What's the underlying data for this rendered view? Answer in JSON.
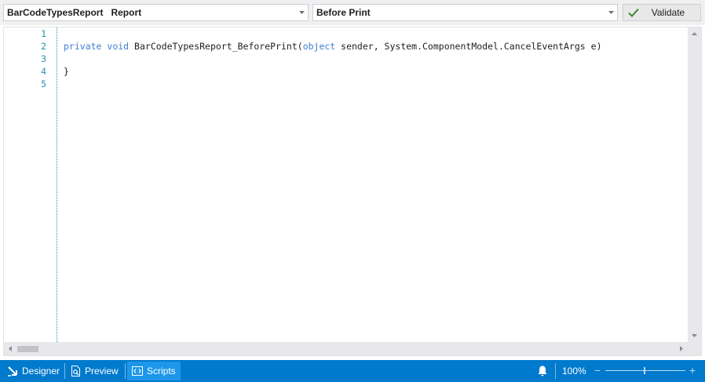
{
  "toolbar": {
    "object_combo_value": "BarCodeTypesReport   Report",
    "event_combo_value": "Before Print",
    "validate_label": "Validate",
    "validate_icon": "check-icon"
  },
  "editor": {
    "line_numbers": [
      "1",
      "2",
      "3",
      "4",
      "5"
    ],
    "lines": {
      "l2_kw1": "private",
      "l2_kw2": "void",
      "l2_name": "BarCodeTypesReport_BeforePrint(",
      "l2_kw3": "object",
      "l2_rest": " sender, System.ComponentModel.CancelEventArgs e)",
      "l4": "}"
    },
    "keyword_color": "#3f7fd0",
    "line_number_color": "#2b91af"
  },
  "statusbar": {
    "tabs": [
      {
        "label": "Designer",
        "icon": "designer-icon"
      },
      {
        "label": "Preview",
        "icon": "preview-icon"
      },
      {
        "label": "Scripts",
        "icon": "scripts-icon"
      }
    ],
    "active_tab": "Scripts",
    "zoom": "100%",
    "zoom_minus": "−",
    "zoom_plus": "+",
    "zoom_level_fraction": 0.5,
    "background_color": "#007acc"
  }
}
